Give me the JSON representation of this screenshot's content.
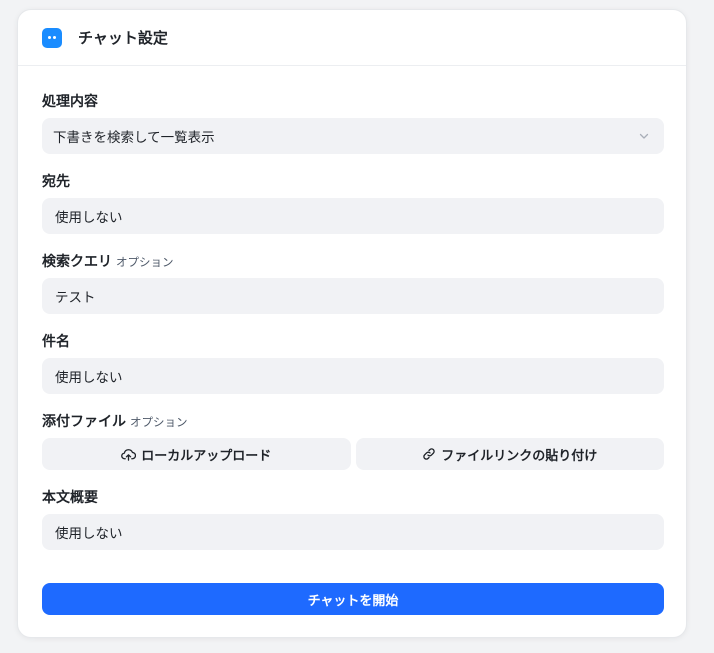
{
  "header": {
    "title": "チャット設定",
    "icon": "chat-bot-icon",
    "icon_color": "#1a8cff"
  },
  "fields": {
    "process": {
      "label": "処理内容",
      "value": "下書きを検索して一覧表示"
    },
    "recipient": {
      "label": "宛先",
      "value": "使用しない"
    },
    "query": {
      "label": "検索クエリ",
      "optional": "オプション",
      "value": "テスト"
    },
    "subject": {
      "label": "件名",
      "value": "使用しない"
    },
    "attachment": {
      "label": "添付ファイル",
      "optional": "オプション",
      "local_upload": "ローカルアップロード",
      "paste_link": "ファイルリンクの貼り付け"
    },
    "summary": {
      "label": "本文概要",
      "value": "使用しない"
    }
  },
  "start_button": {
    "label": "チャットを開始",
    "color": "#1e6aff"
  }
}
